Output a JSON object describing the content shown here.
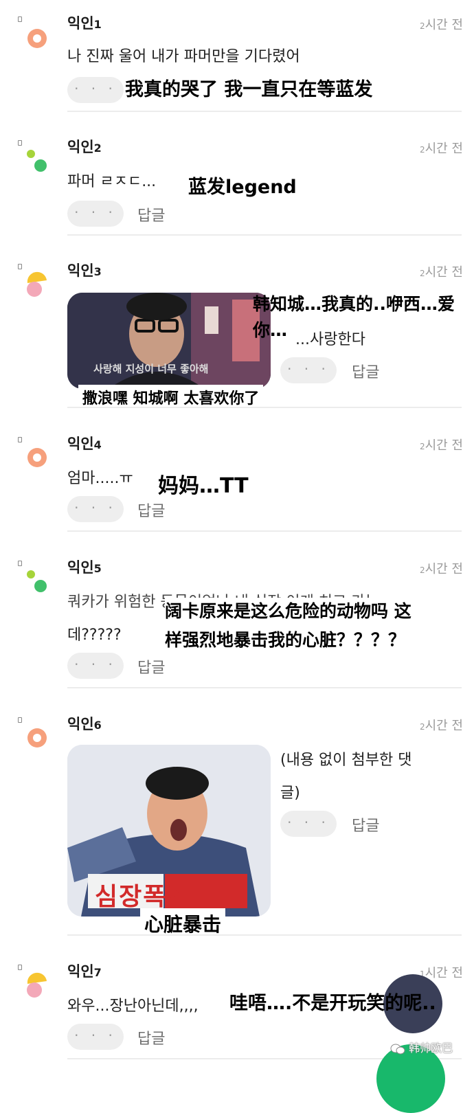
{
  "labels": {
    "more": "· · ·",
    "reply": "답글"
  },
  "colors": {
    "orange_avatar": "#f6a07c",
    "green_avatar": "#41c06b",
    "lime_avatar": "#a6d43a",
    "yellow_avatar": "#f7c531",
    "pink_avatar": "#f3a8b8",
    "fab": "#3a3f58",
    "fab_green": "#18b86b"
  },
  "comments": [
    {
      "author": "익인",
      "num": "1",
      "time_num": "2",
      "time": "시간 전",
      "text": "나 진짜 울어 내가 파머만을 기다렸어",
      "subtitle": "我真的哭了 我一直只在等蓝发",
      "avatar": "orange-avatar"
    },
    {
      "author": "익인",
      "num": "2",
      "time_num": "2",
      "time": "시간 전",
      "text": "파머 ㄹㅈㄷ...",
      "subtitle": "蓝发legend",
      "avatar": "green-dots-avatar"
    },
    {
      "author": "익인",
      "num": "3",
      "time_num": "2",
      "time": "시간 전",
      "text": "...사랑한다",
      "image_caption": "사랑해 지성이 너무 좋아해",
      "subtitle": "韩知城…我真的..咿西…爱你…",
      "image_subtitle": "撒浪嘿 知城啊 太喜欢你了",
      "avatar": "yellow-pink-avatar"
    },
    {
      "author": "익인",
      "num": "4",
      "time_num": "2",
      "time": "시간 전",
      "text": "엄마.....ㅠ",
      "subtitle": "妈妈…TT",
      "avatar": "orange-avatar"
    },
    {
      "author": "익인",
      "num": "5",
      "time_num": "2",
      "time": "시간 전",
      "text": "쿼카가 위험한 동물이었나 내 심장 이게 치고 가는",
      "text2": "데?????",
      "subtitle": "阔卡原来是这么危险的动物吗 这",
      "subtitle2": "样强烈地暴击我的心脏？？？？",
      "avatar": "green-dots-avatar"
    },
    {
      "author": "익인",
      "num": "6",
      "time_num": "2",
      "time": "시간 전",
      "text": "(내용 없이 첨부한 댓",
      "text2": "글)",
      "image_caption": "심장폭격",
      "image_subtitle": "心脏暴击",
      "avatar": "orange-avatar"
    },
    {
      "author": "익인",
      "num": "7",
      "time_num": "1",
      "time": "시간 전",
      "text": "와우...장난아닌데,,,,",
      "subtitle": "哇唔….不是开玩笑的呢..",
      "avatar": "yellow-pink-avatar"
    }
  ],
  "watermark": "韩帅欧巴"
}
